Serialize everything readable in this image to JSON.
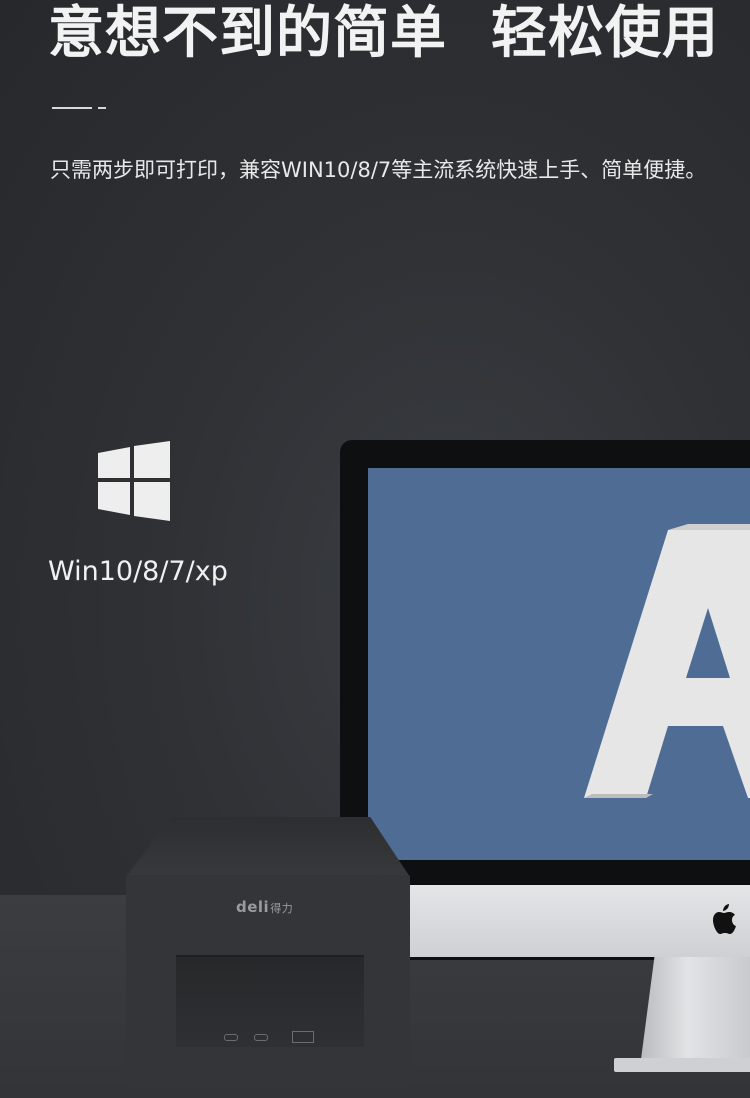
{
  "header": {
    "headline_part1": "意想不到的简单",
    "headline_part2": "轻松使用"
  },
  "description": {
    "text": "只需两步即可打印，兼容WIN10/8/7等主流系统快速上手、简单便捷。"
  },
  "os_support": {
    "icon": "windows-logo-icon",
    "label": "Win10/8/7/xp"
  },
  "printer": {
    "brand": "deli",
    "brand_cn": "得力"
  },
  "monitor": {
    "screen_letter": "A",
    "logo_icon": "apple-logo-icon"
  },
  "colors": {
    "background": "#2b2d30",
    "screen_blue": "#4f6d94",
    "text": "#ffffff"
  }
}
